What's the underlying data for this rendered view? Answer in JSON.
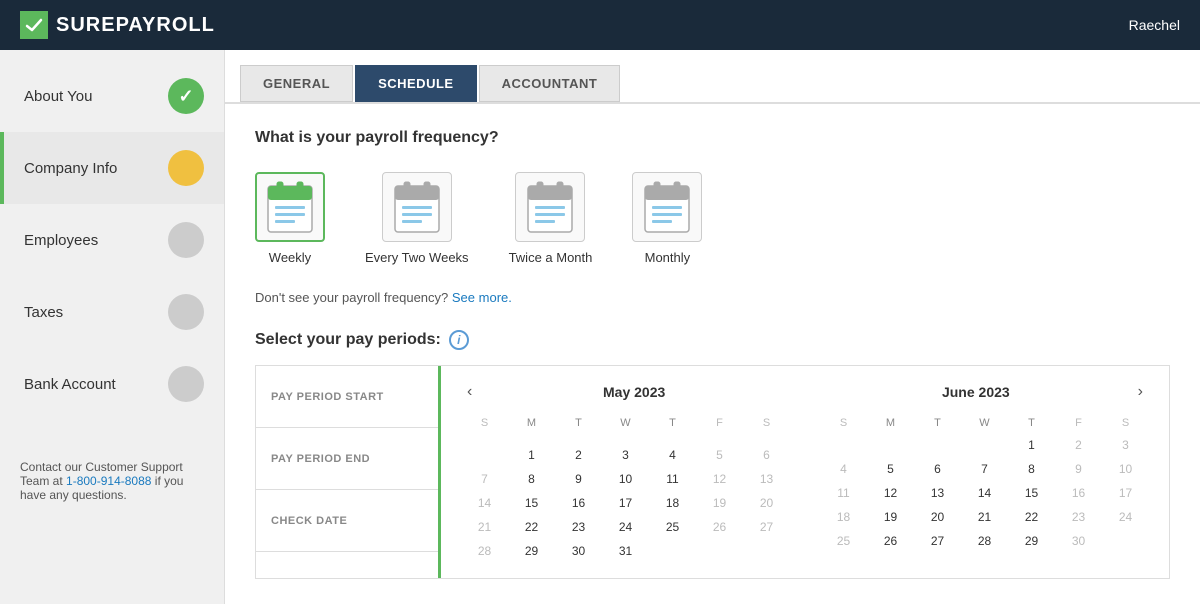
{
  "header": {
    "logo_text_sure": "SURE",
    "logo_text_payroll": "PAYROLL",
    "user_name": "Raechel"
  },
  "sidebar": {
    "items": [
      {
        "id": "about-you",
        "label": "About You",
        "status": "complete",
        "active": false
      },
      {
        "id": "company-info",
        "label": "Company Info",
        "status": "in-progress",
        "active": true
      },
      {
        "id": "employees",
        "label": "Employees",
        "status": "pending",
        "active": false
      },
      {
        "id": "taxes",
        "label": "Taxes",
        "status": "pending",
        "active": false
      },
      {
        "id": "bank-account",
        "label": "Bank Account",
        "status": "pending",
        "active": false
      }
    ],
    "support": {
      "text": "Contact our Customer Support Team at ",
      "phone": "1-800-914-8088",
      "suffix": " if you have any questions."
    }
  },
  "tabs": [
    {
      "id": "general",
      "label": "GENERAL",
      "active": false
    },
    {
      "id": "schedule",
      "label": "SCHEDULE",
      "active": true
    },
    {
      "id": "accountant",
      "label": "ACCOUNTANT",
      "active": false
    }
  ],
  "main": {
    "frequency_title": "What is your payroll frequency?",
    "frequency_options": [
      {
        "id": "weekly",
        "label": "Weekly",
        "selected": true
      },
      {
        "id": "every-two-weeks",
        "label": "Every Two Weeks",
        "selected": false
      },
      {
        "id": "twice-month",
        "label": "Twice a Month",
        "selected": false
      },
      {
        "id": "monthly",
        "label": "Monthly",
        "selected": false
      }
    ],
    "freq_note": "Don't see your payroll frequency?",
    "freq_link": "See more.",
    "pay_period_title": "Select your pay periods:",
    "pay_period_labels": [
      {
        "id": "start",
        "label": "PAY PERIOD START"
      },
      {
        "id": "end",
        "label": "PAY PERIOD END"
      },
      {
        "id": "check",
        "label": "CHECK DATE"
      }
    ],
    "calendar": {
      "may": {
        "title": "May 2023",
        "days_header": [
          "S",
          "M",
          "T",
          "W",
          "T",
          "F",
          "S"
        ],
        "weeks": [
          [
            "",
            "",
            "",
            "",
            "",
            "",
            ""
          ],
          [
            "",
            "1",
            "2",
            "3",
            "4",
            "5",
            "6"
          ],
          [
            "7",
            "8",
            "9",
            "10",
            "11",
            "12",
            "13"
          ],
          [
            "14",
            "15",
            "16",
            "17",
            "18",
            "19",
            "20"
          ],
          [
            "21",
            "22",
            "23",
            "24",
            "25",
            "26",
            "27"
          ],
          [
            "28",
            "29",
            "30",
            "31",
            "",
            "",
            ""
          ]
        ]
      },
      "june": {
        "title": "June 2023",
        "days_header": [
          "S",
          "M",
          "T",
          "W",
          "T",
          "F",
          "S"
        ],
        "weeks": [
          [
            "",
            "",
            "",
            "",
            "1",
            "2",
            "3"
          ],
          [
            "4",
            "5",
            "6",
            "7",
            "8",
            "9",
            "10"
          ],
          [
            "11",
            "12",
            "13",
            "14",
            "15",
            "16",
            "17"
          ],
          [
            "18",
            "19",
            "20",
            "21",
            "22",
            "23",
            "24"
          ],
          [
            "25",
            "26",
            "27",
            "28",
            "29",
            "30",
            ""
          ]
        ]
      }
    }
  }
}
